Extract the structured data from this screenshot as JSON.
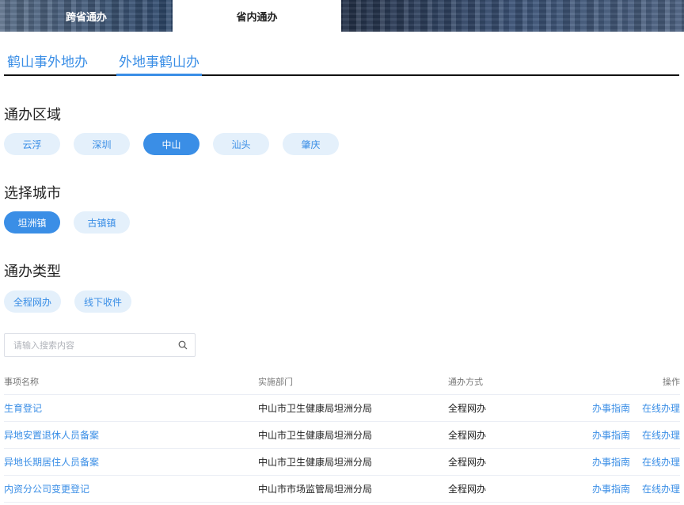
{
  "top_tabs": {
    "cross_province": "跨省通办",
    "in_province": "省内通办"
  },
  "sub_tabs": {
    "tab1": "鹤山事外地办",
    "tab2": "外地事鹤山办"
  },
  "sections": {
    "area": {
      "title": "通办区域",
      "options": [
        "云浮",
        "深圳",
        "中山",
        "汕头",
        "肇庆"
      ],
      "selected": "中山"
    },
    "city": {
      "title": "选择城市",
      "options": [
        "坦洲镇",
        "古镇镇"
      ],
      "selected": "坦洲镇"
    },
    "type": {
      "title": "通办类型",
      "options": [
        "全程网办",
        "线下收件"
      ],
      "selected": ""
    }
  },
  "search": {
    "placeholder": "请输入搜索内容",
    "icon": "search-icon"
  },
  "table": {
    "headers": {
      "name": "事项名称",
      "dept": "实施部门",
      "mode": "通办方式",
      "ops": "操作"
    },
    "rows": [
      {
        "name": "生育登记",
        "dept": "中山市卫生健康局坦洲分局",
        "mode": "全程网办",
        "guide": "办事指南",
        "online": "在线办理"
      },
      {
        "name": "异地安置退休人员备案",
        "dept": "中山市卫生健康局坦洲分局",
        "mode": "全程网办",
        "guide": "办事指南",
        "online": "在线办理"
      },
      {
        "name": "异地长期居住人员备案",
        "dept": "中山市卫生健康局坦洲分局",
        "mode": "全程网办",
        "guide": "办事指南",
        "online": "在线办理"
      },
      {
        "name": "内资分公司变更登记",
        "dept": "中山市市场监管局坦洲分局",
        "mode": "全程网办",
        "guide": "办事指南",
        "online": "在线办理"
      }
    ]
  },
  "colors": {
    "accent": "#3a8ee6",
    "pill_bg": "#e4f0fb"
  }
}
